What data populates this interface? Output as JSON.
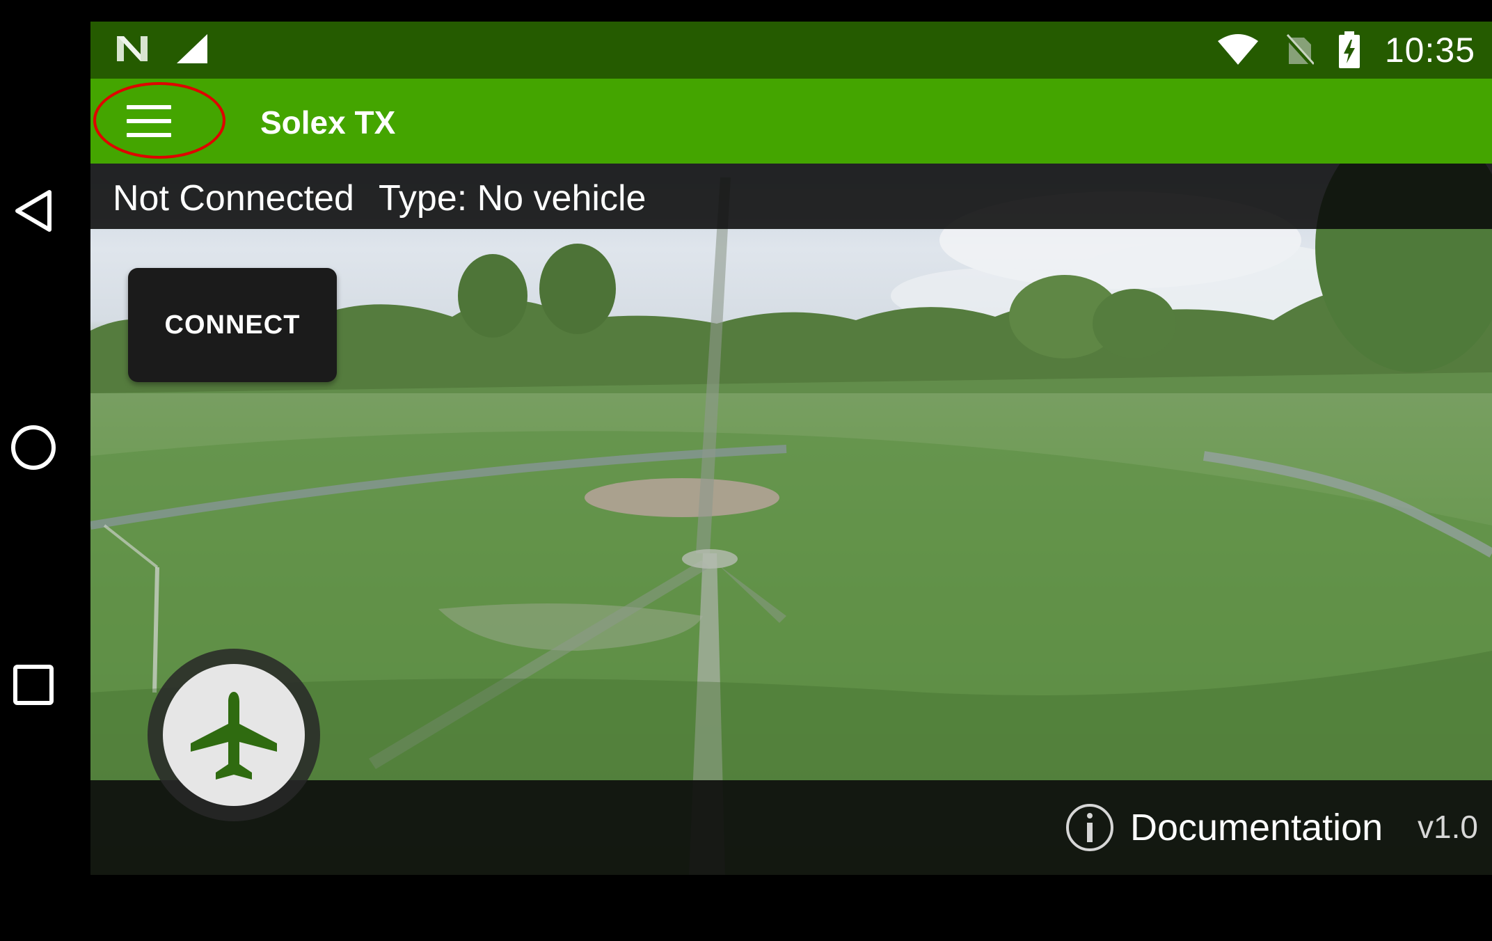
{
  "status_bar": {
    "time": "10:35",
    "left_icons": [
      "notification-n-icon",
      "cell-signal-icon"
    ],
    "right_icons": [
      "wifi-icon",
      "no-sim-icon",
      "battery-charging-icon"
    ]
  },
  "app_bar": {
    "title": "Solex TX",
    "menu_icon": "hamburger-menu-icon"
  },
  "connection": {
    "status": "Not Connected",
    "vehicle_type": "Type: No vehicle"
  },
  "connect_button": {
    "label": "CONNECT"
  },
  "footer": {
    "documentation_label": "Documentation",
    "version": "v1.0"
  },
  "fab": {
    "icon": "airplane-icon"
  },
  "system_nav": {
    "items": [
      "back-icon",
      "home-icon",
      "recents-icon"
    ]
  },
  "colors": {
    "status_bar": "#255b00",
    "app_bar": "#44a500",
    "fab_icon": "#2f6b10",
    "annotation": "#e00000"
  }
}
